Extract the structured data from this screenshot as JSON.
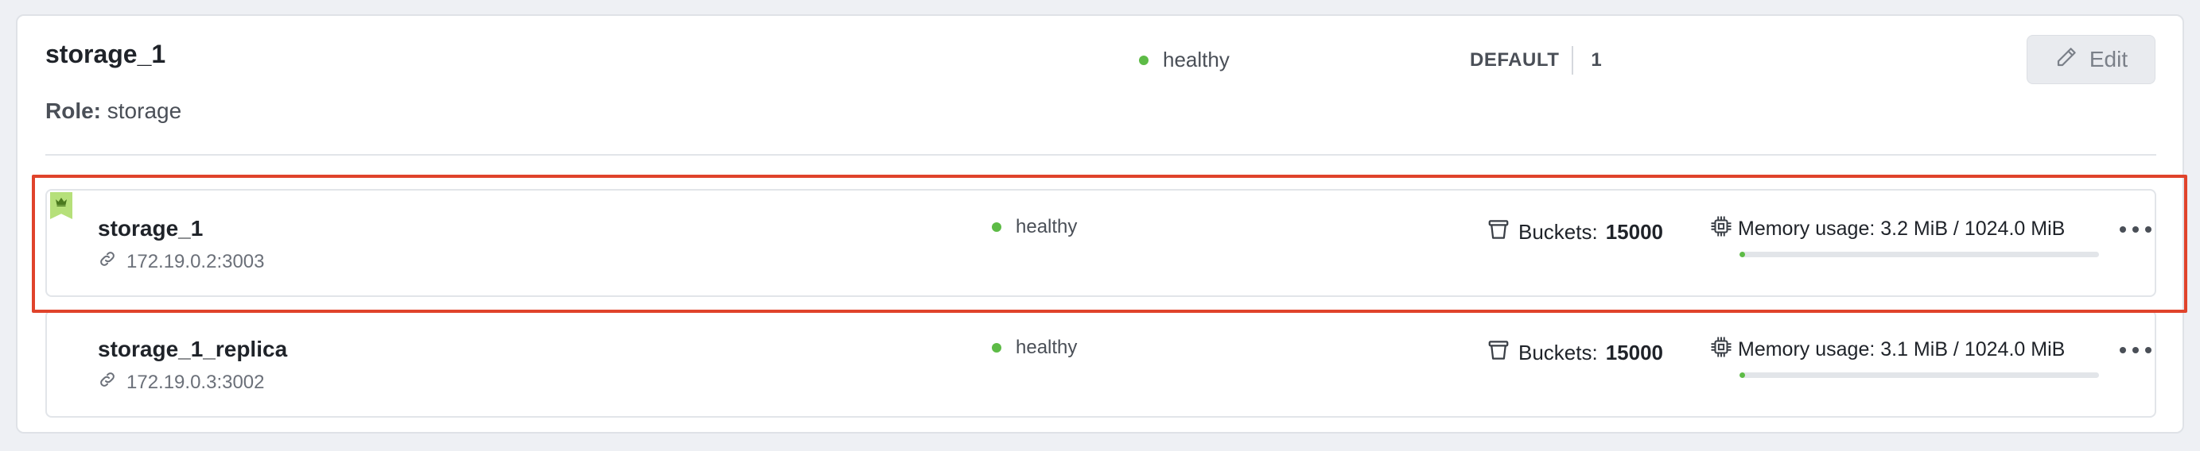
{
  "replicaset": {
    "name": "storage_1",
    "status": "healthy",
    "status_color": "#5dbb46",
    "group_label": "DEFAULT",
    "weight": "1",
    "edit_label": "Edit",
    "role_label": "Role:",
    "role_value": "storage"
  },
  "instances": [
    {
      "name": "storage_1",
      "uri": "172.19.0.2:3003",
      "status": "healthy",
      "leader": true,
      "buckets_label": "Buckets:",
      "buckets_value": "15000",
      "memory_label": "Memory usage: 3.2 MiB / 1024.0 MiB",
      "memory_fraction": 0.003
    },
    {
      "name": "storage_1_replica",
      "uri": "172.19.0.3:3002",
      "status": "healthy",
      "leader": false,
      "buckets_label": "Buckets:",
      "buckets_value": "15000",
      "memory_label": "Memory usage: 3.1 MiB / 1024.0 MiB",
      "memory_fraction": 0.003
    }
  ],
  "colors": {
    "accent_highlight": "#e0432b",
    "leader_badge": "#b6e07a",
    "memory_bar": "#5dbb46"
  },
  "icons": {
    "edit": "pencil-icon",
    "leader": "crown-icon",
    "uri": "link-icon",
    "buckets": "bucket-icon",
    "memory": "chip-icon",
    "more": "more-horizontal-icon"
  }
}
